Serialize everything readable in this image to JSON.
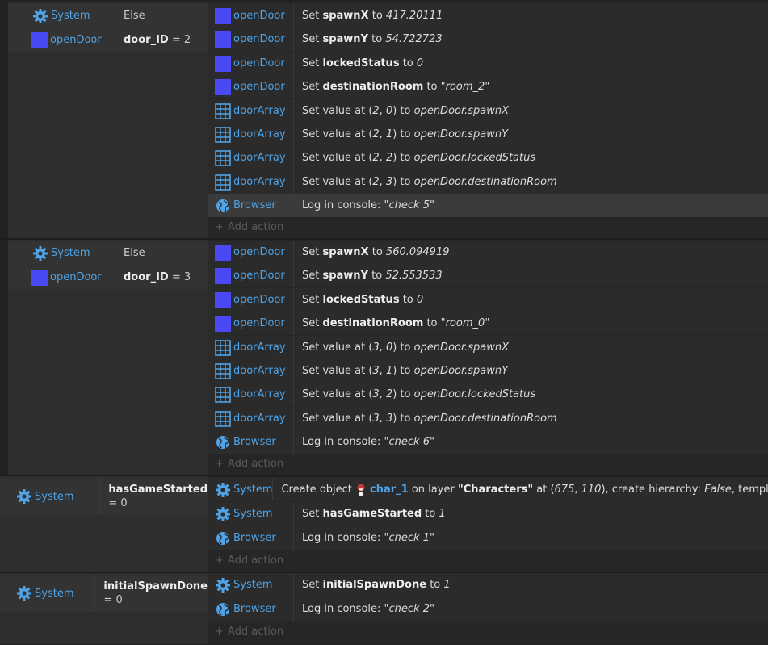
{
  "colors": {
    "accent_blue": "#4fa3e6",
    "sprite_square": "#4a4af5",
    "bg": "#222222"
  },
  "icons": {
    "system": "gear-icon",
    "sprite": "sprite-square-icon",
    "array": "grid-array-icon",
    "browser": "globe-icon",
    "character": "character-sprite-icon"
  },
  "common": {
    "add_action": "Add action"
  },
  "blocks": [
    {
      "conditions": [
        {
          "object": "System",
          "text": "Else"
        },
        {
          "object": "openDoor",
          "var": "door_ID",
          "rest": " = 2"
        }
      ],
      "actions": [
        {
          "object": "openDoor",
          "pre": "Set ",
          "bold": "spawnX",
          "mid": " to ",
          "italic": "417.20111",
          "post": ""
        },
        {
          "object": "openDoor",
          "pre": "Set ",
          "bold": "spawnY",
          "mid": " to ",
          "italic": "54.722723",
          "post": ""
        },
        {
          "object": "openDoor",
          "pre": "Set ",
          "bold": "lockedStatus",
          "mid": " to ",
          "italic": "0",
          "post": ""
        },
        {
          "object": "openDoor",
          "pre": "Set ",
          "bold": "destinationRoom",
          "mid": " to ",
          "italic": "\"room_2\"",
          "post": ""
        },
        {
          "object": "doorArray",
          "pre": "Set value at (",
          "i1": "2",
          "c1": ", ",
          "i2": "0",
          "c2": ") to ",
          "i3": "openDoor.spawnX"
        },
        {
          "object": "doorArray",
          "pre": "Set value at (",
          "i1": "2",
          "c1": ", ",
          "i2": "1",
          "c2": ") to ",
          "i3": "openDoor.spawnY"
        },
        {
          "object": "doorArray",
          "pre": "Set value at (",
          "i1": "2",
          "c1": ", ",
          "i2": "2",
          "c2": ") to ",
          "i3": "openDoor.lockedStatus"
        },
        {
          "object": "doorArray",
          "pre": "Set value at (",
          "i1": "2",
          "c1": ", ",
          "i2": "3",
          "c2": ") to ",
          "i3": "openDoor.destinationRoom"
        },
        {
          "object": "Browser",
          "pre": "Log in console: ",
          "italic": "\"check 5\""
        }
      ]
    },
    {
      "conditions": [
        {
          "object": "System",
          "text": "Else"
        },
        {
          "object": "openDoor",
          "var": "door_ID",
          "rest": " = 3"
        }
      ],
      "actions": [
        {
          "object": "openDoor",
          "pre": "Set ",
          "bold": "spawnX",
          "mid": " to ",
          "italic": "560.094919"
        },
        {
          "object": "openDoor",
          "pre": "Set ",
          "bold": "spawnY",
          "mid": " to ",
          "italic": "52.553533"
        },
        {
          "object": "openDoor",
          "pre": "Set ",
          "bold": "lockedStatus",
          "mid": " to ",
          "italic": "0"
        },
        {
          "object": "openDoor",
          "pre": "Set ",
          "bold": "destinationRoom",
          "mid": " to ",
          "italic": "\"room_0\""
        },
        {
          "object": "doorArray",
          "pre": "Set value at (",
          "i1": "3",
          "c1": ", ",
          "i2": "0",
          "c2": ") to ",
          "i3": "openDoor.spawnX"
        },
        {
          "object": "doorArray",
          "pre": "Set value at (",
          "i1": "3",
          "c1": ", ",
          "i2": "1",
          "c2": ") to ",
          "i3": "openDoor.spawnY"
        },
        {
          "object": "doorArray",
          "pre": "Set value at (",
          "i1": "3",
          "c1": ", ",
          "i2": "2",
          "c2": ") to ",
          "i3": "openDoor.lockedStatus"
        },
        {
          "object": "doorArray",
          "pre": "Set value at (",
          "i1": "3",
          "c1": ", ",
          "i2": "3",
          "c2": ") to ",
          "i3": "openDoor.destinationRoom"
        },
        {
          "object": "Browser",
          "pre": "Log in console: ",
          "italic": "\"check 6\""
        }
      ]
    },
    {
      "conditions": [
        {
          "object": "System",
          "var": "hasGameStarted",
          "rest": " = 0"
        }
      ],
      "actions": [
        {
          "object": "System",
          "pre": "Create object ",
          "sprite": "char_1",
          "a": " on layer ",
          "b1": "\"Characters\"",
          "a2": " at (",
          "i1": "675",
          "c1": ", ",
          "i2": "110",
          "a3": "), create hierarchy: ",
          "i3": "False",
          "a4": ", template: \"\""
        },
        {
          "object": "System",
          "pre": "Set ",
          "bold": "hasGameStarted",
          "mid": " to ",
          "italic": "1"
        },
        {
          "object": "Browser",
          "pre": "Log in console: ",
          "italic": "\"check 1\""
        }
      ]
    },
    {
      "conditions": [
        {
          "object": "System",
          "var": "initialSpawnDone",
          "rest": " = 0"
        }
      ],
      "actions": [
        {
          "object": "System",
          "pre": "Set ",
          "bold": "initialSpawnDone",
          "mid": " to ",
          "italic": "1"
        },
        {
          "object": "Browser",
          "pre": "Log in console: ",
          "italic": "\"check 2\""
        }
      ]
    }
  ]
}
